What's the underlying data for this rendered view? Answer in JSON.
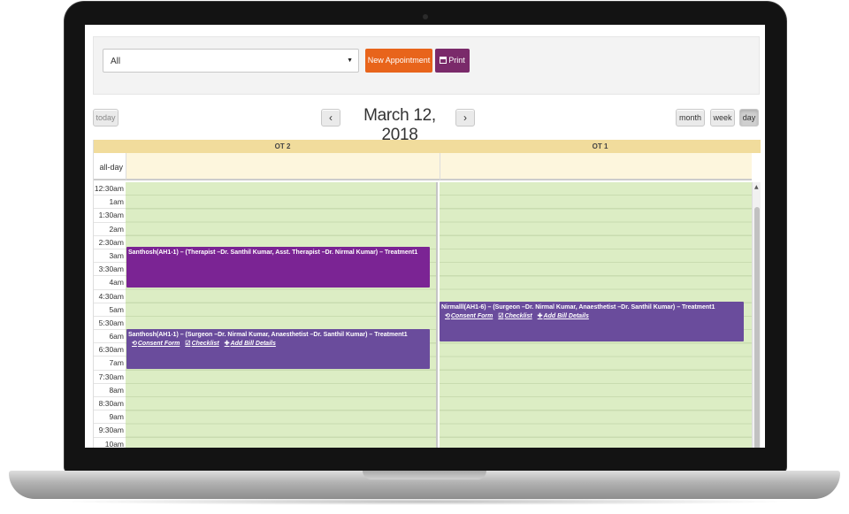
{
  "toolbar": {
    "filter_value": "All",
    "new_appointment_label": "New Appointment",
    "print_label": "Print"
  },
  "nav": {
    "today_label": "today",
    "prev_label": "‹",
    "next_label": "›",
    "title": "March 12, 2018",
    "views": {
      "month": "month",
      "week": "week",
      "day": "day"
    },
    "active_view": "day"
  },
  "calendar": {
    "columns": [
      "OT 2",
      "OT 1"
    ],
    "allday_label": "all-day",
    "times": [
      "12:30am",
      "1am",
      "1:30am",
      "2am",
      "2:30am",
      "3am",
      "3:30am",
      "4am",
      "4:30am",
      "5am",
      "5:30am",
      "6am",
      "6:30am",
      "7am",
      "7:30am",
      "8am",
      "8:30am",
      "9am",
      "9:30am",
      "10am"
    ],
    "events": [
      {
        "text": "Santhosh(AH1-1) – (Therapist –Dr. Santhil Kumar, Asst. Therapist –Dr. Nirmal Kumar) – Treatment1",
        "color": "#7b2494"
      },
      {
        "text": "Santhosh(AH1-1) – (Surgeon –Dr. Nirmal Kumar, Anaesthetist –Dr. Santhil Kumar) – Treatment1",
        "consent": "Consent Form",
        "checklist": "Checklist",
        "bill": "Add Bill Details",
        "color": "#6a4c9c"
      },
      {
        "text": "Nirmalll(AH1-6) – (Surgeon –Dr. Nirmal Kumar, Anaesthetist –Dr. Santhil Kumar) – Treatment1",
        "consent": "Consent Form",
        "checklist": "Checklist",
        "bill": "Add Bill Details",
        "color": "#6a4c9c"
      }
    ]
  },
  "colors": {
    "accent_orange": "#e8641b",
    "accent_purple": "#7a2a6a",
    "header_gold": "#f1dc9c",
    "slot_green": "#dcedc4"
  }
}
